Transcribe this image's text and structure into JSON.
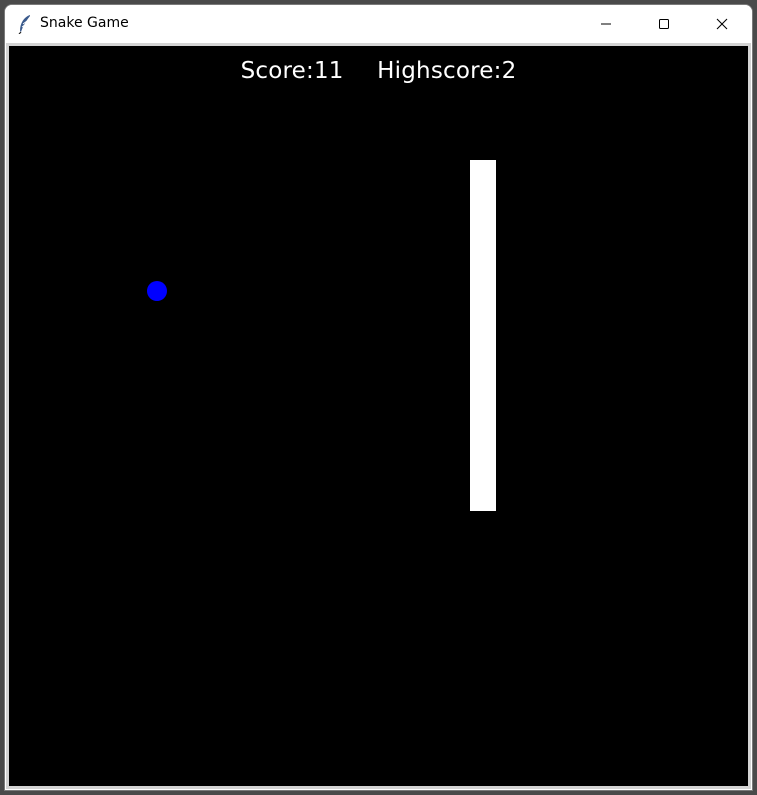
{
  "window": {
    "title": "Snake Game"
  },
  "titlebar": {
    "icons": [
      "feather-icon",
      "minimize-icon",
      "maximize-icon",
      "close-icon"
    ]
  },
  "hud": {
    "score_text": "Score:11",
    "highscore_text": "Highscore:2"
  },
  "game": {
    "score": 11,
    "highscore": 2,
    "background_color": "#000000",
    "snake_color": "#ffffff",
    "food_color": "#0000ff"
  }
}
